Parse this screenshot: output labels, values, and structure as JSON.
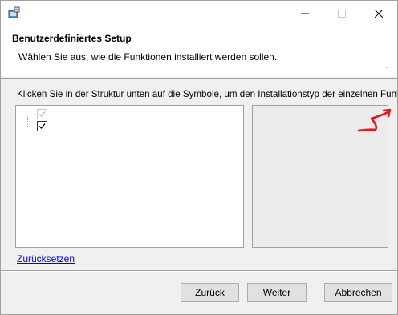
{
  "window": {
    "icons": {
      "app": "installer-icon",
      "minimize": "minimize-icon",
      "maximize": "maximize-icon",
      "close": "close-icon"
    }
  },
  "header": {
    "title": "Benutzerdefiniertes Setup",
    "subtitle": "Wählen Sie aus, wie die Funktionen installiert werden sollen."
  },
  "main": {
    "instruction": "Klicken Sie in der Struktur unten auf die Symbole, um den Installationstyp der einzelnen Funktionen zu",
    "tree": [
      {
        "checked": true,
        "disabled": true
      },
      {
        "checked": true,
        "disabled": false
      }
    ],
    "reset_link": "Zurücksetzen"
  },
  "footer": {
    "back_label": "Zurück",
    "next_label": "Weiter",
    "cancel_label": "Abbrechen"
  },
  "colors": {
    "annotation": "#e0191c",
    "link": "#0000ee"
  }
}
